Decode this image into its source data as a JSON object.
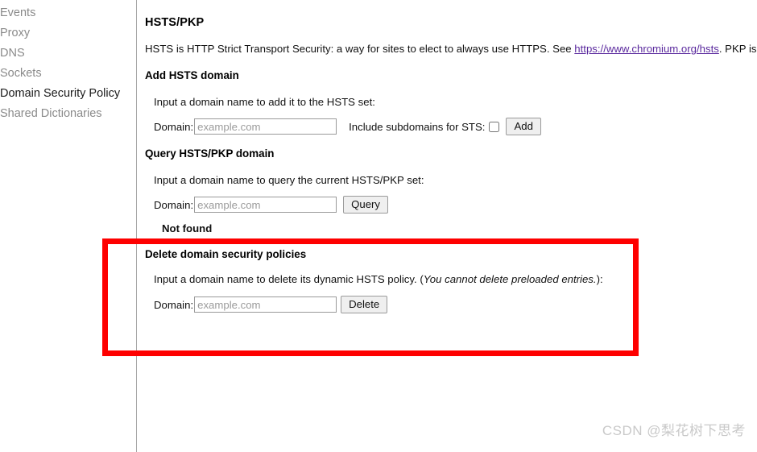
{
  "sidebar": {
    "items": [
      {
        "label": "Events",
        "active": false
      },
      {
        "label": "Proxy",
        "active": false
      },
      {
        "label": "DNS",
        "active": false
      },
      {
        "label": "Sockets",
        "active": false
      },
      {
        "label": "Domain Security Policy",
        "active": true
      },
      {
        "label": "Shared Dictionaries",
        "active": false
      }
    ]
  },
  "main": {
    "page_title": "HSTS/PKP",
    "intro": {
      "before_link": "HSTS is HTTP Strict Transport Security: a way for sites to elect to always use HTTPS. See ",
      "link_text": "https://www.chromium.org/hsts",
      "after_link": ". PKP is Public Key Pinnin"
    },
    "add_section": {
      "heading": "Add HSTS domain",
      "description": "Input a domain name to add it to the HSTS set:",
      "domain_label": "Domain:",
      "domain_value": "",
      "domain_placeholder": "example.com",
      "checkbox_label": "Include subdomains for STS:",
      "checkbox_checked": false,
      "button_label": "Add"
    },
    "query_section": {
      "heading": "Query HSTS/PKP domain",
      "description": "Input a domain name to query the current HSTS/PKP set:",
      "domain_label": "Domain:",
      "domain_value": "",
      "domain_placeholder": "example.com",
      "button_label": "Query",
      "result": "Not found"
    },
    "delete_section": {
      "heading": "Delete domain security policies",
      "description_plain_start": "Input a domain name to delete its dynamic HSTS policy. (",
      "description_italic": "You cannot delete preloaded entries.",
      "description_plain_end": "):",
      "domain_label": "Domain:",
      "domain_value": "",
      "domain_placeholder": "example.com",
      "button_label": "Delete"
    }
  },
  "annotation": {
    "highlight_color": "#fe0000"
  },
  "watermark": {
    "text": "CSDN @梨花树下思考"
  }
}
